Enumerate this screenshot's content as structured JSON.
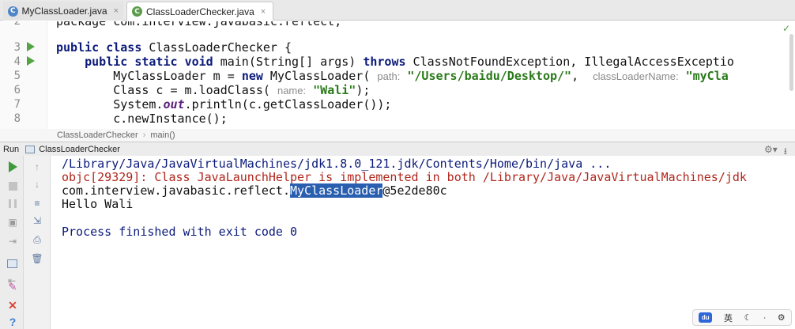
{
  "tabs": [
    {
      "label": "MyClassLoader.java",
      "close": "×",
      "icon": "java-class-icon"
    },
    {
      "label": "ClassLoaderChecker.java",
      "close": "×",
      "icon": "java-class-icon"
    }
  ],
  "editor": {
    "lines": [
      {
        "num": "2",
        "code": "package com.interview.javabasic.reflect;"
      },
      {
        "num": "3"
      },
      {
        "num": "4"
      },
      {
        "num": "5"
      },
      {
        "num": "6"
      },
      {
        "num": "7"
      },
      {
        "num": "8"
      }
    ],
    "line3": {
      "kw1": "public",
      "kw2": "class",
      "rest": " ClassLoaderChecker {"
    },
    "line4": {
      "kw1": "public",
      "kw2": "static",
      "kw3": "void",
      "mid": " main(String[] args) ",
      "kw4": "throws",
      "rest": " ClassNotFoundException, IllegalAccessExceptio"
    },
    "line5": {
      "pre": "MyClassLoader m = ",
      "kw": "new",
      "mid": " MyClassLoader(",
      "hint1": "path:",
      "str1": "\"/Users/baidu/Desktop/\"",
      "comma": ",",
      "hint2": "classLoaderName:",
      "str2": "\"myCla"
    },
    "line6": {
      "pre": "Class c = m.loadClass(",
      "hint": "name:",
      "str": "\"Wali\"",
      "post": ");"
    },
    "line7": {
      "pre": "System.",
      "it": "out",
      "post": ".println(c.getClassLoader());"
    },
    "line8": {
      "code": "c.newInstance();"
    }
  },
  "breadcrumb": [
    "ClassLoaderChecker",
    "main()"
  ],
  "run_panel": {
    "label": "Run",
    "config": "ClassLoaderChecker"
  },
  "console": {
    "cmd": "/Library/Java/JavaVirtualMachines/jdk1.8.0_121.jdk/Contents/Home/bin/java ...",
    "err": "objc[29329]: Class JavaLaunchHelper is implemented in both /Library/Java/JavaVirtualMachines/jdk",
    "out_pre": "com.interview.javabasic.reflect.",
    "out_sel": "MyClassLoader",
    "out_post": "@5e2de80c",
    "hello": "Hello Wali",
    "finish": "Process finished with exit code 0"
  },
  "ime": {
    "lang": "英"
  }
}
